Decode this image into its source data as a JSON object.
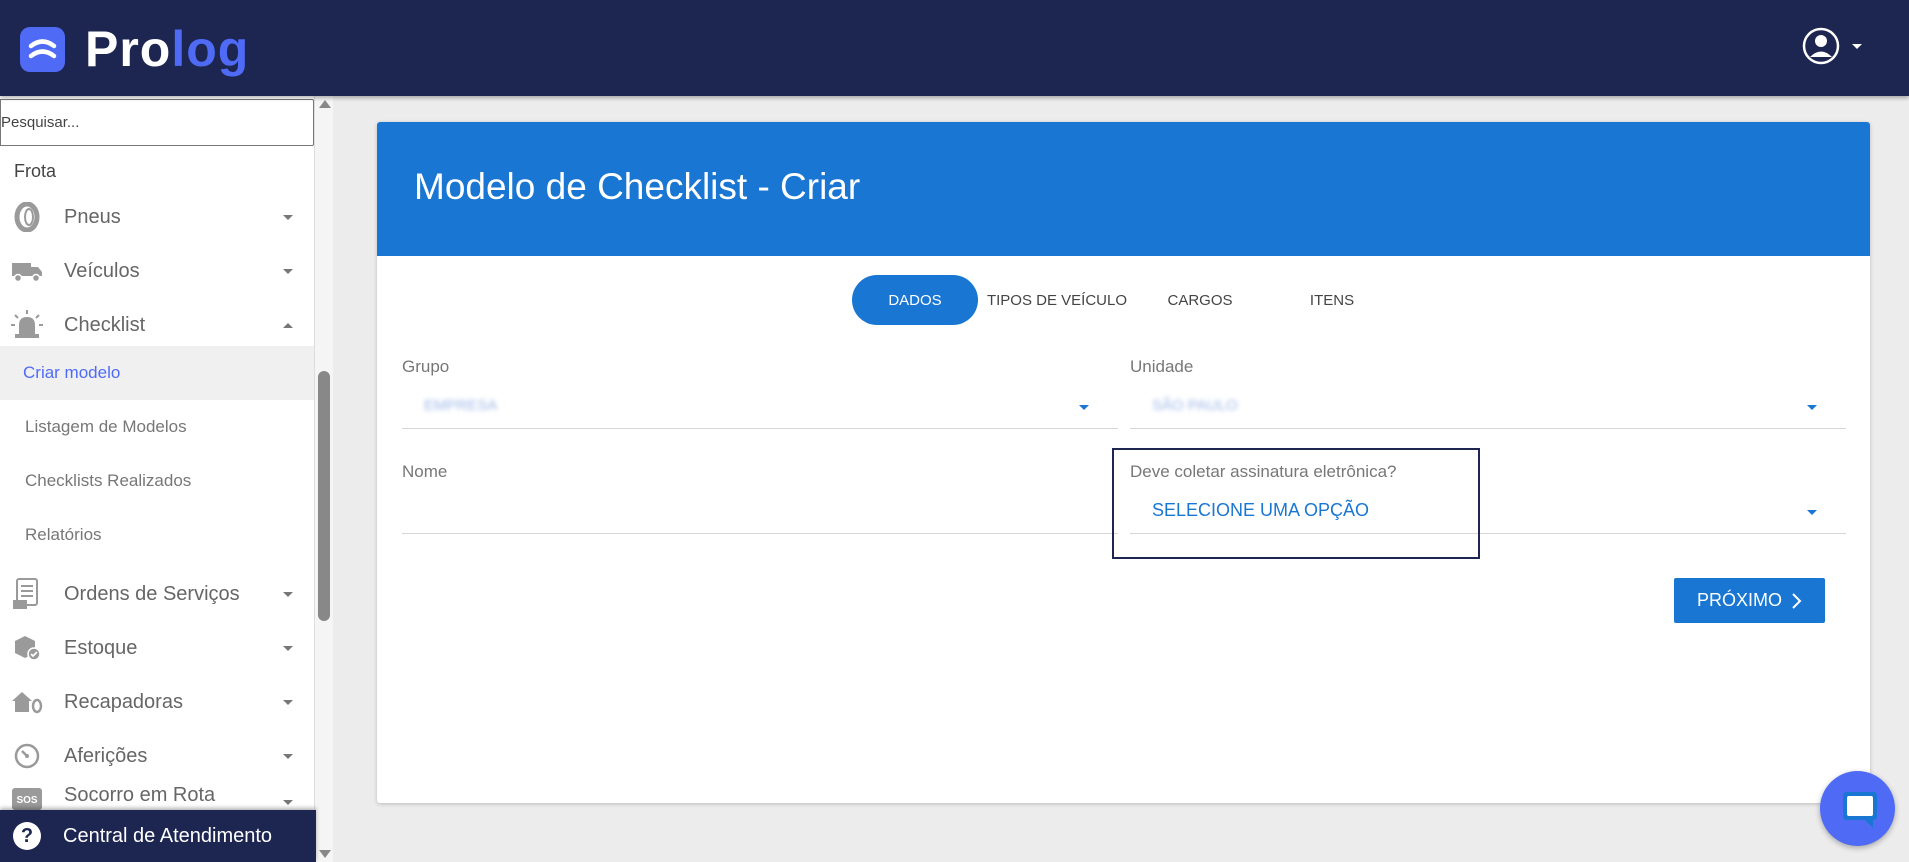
{
  "app": {
    "logo": {
      "text_white": "Pro",
      "text_blue": "log"
    },
    "colors": {
      "topbar": "#1d2551",
      "accent": "#1976d2",
      "brand": "#4f6bf6"
    }
  },
  "sidebar": {
    "search_placeholder": "Pesquisar...",
    "section_title": "Frota",
    "items": [
      {
        "label": "Pneus",
        "icon": "tire-icon"
      },
      {
        "label": "Veículos",
        "icon": "truck-icon"
      },
      {
        "label": "Checklist",
        "icon": "alarm-light-icon",
        "expanded": true
      }
    ],
    "checklist_subitems": [
      {
        "label": "Criar modelo",
        "active": true
      },
      {
        "label": "Listagem de Modelos"
      },
      {
        "label": "Checklists Realizados"
      },
      {
        "label": "Relatórios"
      }
    ],
    "items_after": [
      {
        "label": "Ordens de Serviços",
        "icon": "document-list-icon"
      },
      {
        "label": "Estoque",
        "icon": "box-check-icon"
      },
      {
        "label": "Recapadoras",
        "icon": "house-tire-icon"
      },
      {
        "label": "Aferições",
        "icon": "gauge-icon"
      },
      {
        "label": "Socorro em Rota",
        "icon": "sos-icon"
      }
    ],
    "help_label": "Central de Atendimento"
  },
  "main": {
    "title": "Modelo de Checklist - Criar",
    "tabs": [
      {
        "label": "DADOS",
        "active": true
      },
      {
        "label": "TIPOS DE VEÍCULO"
      },
      {
        "label": "CARGOS"
      },
      {
        "label": "ITENS"
      }
    ],
    "fields": {
      "grupo": {
        "label": "Grupo",
        "value": "EMPRESA"
      },
      "unidade": {
        "label": "Unidade",
        "value": "SÃO PAULO"
      },
      "nome": {
        "label": "Nome",
        "value": ""
      },
      "assinatura": {
        "label": "Deve coletar assinatura eletrônica?",
        "value": "SELECIONE UMA OPÇÃO"
      }
    },
    "next_button": "PRÓXIMO"
  }
}
